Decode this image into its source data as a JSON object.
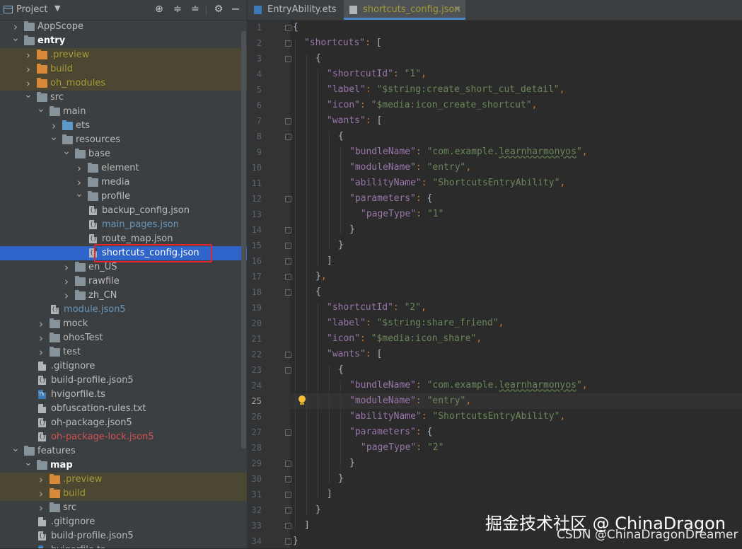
{
  "project": {
    "title": "Project",
    "icons": {
      "toggle": "chevron-down-icon",
      "locate": "crosshair-icon",
      "expand_all": "expand-all-icon",
      "collapse_all": "collapse-all-icon",
      "settings": "gear-icon"
    },
    "tree": [
      {
        "label": "AppScope",
        "depth": 0,
        "kind": "folder",
        "arrow": "collapsed",
        "style": "normal"
      },
      {
        "label": "entry",
        "depth": 0,
        "kind": "module",
        "arrow": "expanded",
        "style": "bold"
      },
      {
        "label": ".preview",
        "depth": 1,
        "kind": "folder-excluded",
        "arrow": "collapsed",
        "style": "yellow",
        "excluded": true
      },
      {
        "label": "build",
        "depth": 1,
        "kind": "folder-excluded",
        "arrow": "collapsed",
        "style": "yellow",
        "excluded": true
      },
      {
        "label": "oh_modules",
        "depth": 1,
        "kind": "folder-excluded",
        "arrow": "collapsed",
        "style": "yellow",
        "excluded": true
      },
      {
        "label": "src",
        "depth": 1,
        "kind": "folder",
        "arrow": "expanded",
        "style": "normal"
      },
      {
        "label": "main",
        "depth": 2,
        "kind": "folder",
        "arrow": "expanded",
        "style": "normal"
      },
      {
        "label": "ets",
        "depth": 3,
        "kind": "folder-source",
        "arrow": "collapsed",
        "style": "normal"
      },
      {
        "label": "resources",
        "depth": 3,
        "kind": "folder",
        "arrow": "expanded",
        "style": "normal"
      },
      {
        "label": "base",
        "depth": 4,
        "kind": "folder",
        "arrow": "expanded",
        "style": "normal"
      },
      {
        "label": "element",
        "depth": 5,
        "kind": "folder",
        "arrow": "collapsed",
        "style": "normal"
      },
      {
        "label": "media",
        "depth": 5,
        "kind": "folder",
        "arrow": "collapsed",
        "style": "normal"
      },
      {
        "label": "profile",
        "depth": 5,
        "kind": "folder",
        "arrow": "expanded",
        "style": "normal"
      },
      {
        "label": "backup_config.json",
        "depth": 6,
        "kind": "json",
        "arrow": "none",
        "style": "normal"
      },
      {
        "label": "main_pages.json",
        "depth": 6,
        "kind": "json",
        "arrow": "none",
        "style": "blue"
      },
      {
        "label": "route_map.json",
        "depth": 6,
        "kind": "json",
        "arrow": "none",
        "style": "normal"
      },
      {
        "label": "shortcuts_config.json",
        "depth": 6,
        "kind": "json",
        "arrow": "none",
        "style": "white",
        "selected": true
      },
      {
        "label": "en_US",
        "depth": 4,
        "kind": "folder",
        "arrow": "collapsed",
        "style": "normal"
      },
      {
        "label": "rawfile",
        "depth": 4,
        "kind": "folder",
        "arrow": "collapsed",
        "style": "normal"
      },
      {
        "label": "zh_CN",
        "depth": 4,
        "kind": "folder",
        "arrow": "collapsed",
        "style": "normal"
      },
      {
        "label": "module.json5",
        "depth": 3,
        "kind": "json",
        "arrow": "none",
        "style": "blue"
      },
      {
        "label": "mock",
        "depth": 2,
        "kind": "folder",
        "arrow": "collapsed",
        "style": "normal"
      },
      {
        "label": "ohosTest",
        "depth": 2,
        "kind": "folder",
        "arrow": "collapsed",
        "style": "normal"
      },
      {
        "label": "test",
        "depth": 2,
        "kind": "folder",
        "arrow": "collapsed",
        "style": "normal"
      },
      {
        "label": ".gitignore",
        "depth": 2,
        "kind": "file",
        "arrow": "none",
        "style": "normal"
      },
      {
        "label": "build-profile.json5",
        "depth": 2,
        "kind": "json",
        "arrow": "none",
        "style": "normal"
      },
      {
        "label": "hvigorfile.ts",
        "depth": 2,
        "kind": "ts",
        "arrow": "none",
        "style": "normal"
      },
      {
        "label": "obfuscation-rules.txt",
        "depth": 2,
        "kind": "file",
        "arrow": "none",
        "style": "normal"
      },
      {
        "label": "oh-package.json5",
        "depth": 2,
        "kind": "json",
        "arrow": "none",
        "style": "normal"
      },
      {
        "label": "oh-package-lock.json5",
        "depth": 2,
        "kind": "json",
        "arrow": "none",
        "style": "red"
      },
      {
        "label": "features",
        "depth": 0,
        "kind": "folder",
        "arrow": "expanded",
        "style": "normal"
      },
      {
        "label": "map",
        "depth": 1,
        "kind": "module",
        "arrow": "expanded",
        "style": "bold"
      },
      {
        "label": ".preview",
        "depth": 2,
        "kind": "folder-excluded",
        "arrow": "collapsed",
        "style": "yellow",
        "excluded": true
      },
      {
        "label": "build",
        "depth": 2,
        "kind": "folder-excluded",
        "arrow": "collapsed",
        "style": "yellow",
        "excluded": true
      },
      {
        "label": "src",
        "depth": 2,
        "kind": "folder",
        "arrow": "collapsed",
        "style": "normal"
      },
      {
        "label": ".gitignore",
        "depth": 2,
        "kind": "file",
        "arrow": "none",
        "style": "normal"
      },
      {
        "label": "build-profile.json5",
        "depth": 2,
        "kind": "json",
        "arrow": "none",
        "style": "normal"
      },
      {
        "label": "hvigorfile.ts",
        "depth": 2,
        "kind": "ts",
        "arrow": "none",
        "style": "normal"
      }
    ]
  },
  "editor": {
    "tabs": [
      {
        "label": "EntryAbility.ets",
        "icon": "ets-file-icon",
        "active": false
      },
      {
        "label": "shortcuts_config.json",
        "icon": "json-file-icon",
        "active": true
      }
    ],
    "current_line": 25,
    "lines": [
      [
        [
          "b",
          "{"
        ]
      ],
      [
        [
          "k",
          "\"shortcuts\""
        ],
        [
          "p",
          ": "
        ],
        [
          "b",
          "["
        ]
      ],
      [
        [
          "b",
          "{"
        ]
      ],
      [
        [
          "k",
          "\"shortcutId\""
        ],
        [
          "p",
          ": "
        ],
        [
          "s",
          "\"1\""
        ],
        [
          "p",
          ","
        ]
      ],
      [
        [
          "k",
          "\"label\""
        ],
        [
          "p",
          ": "
        ],
        [
          "s",
          "\"$string:create_short_cut_detail\""
        ],
        [
          "p",
          ","
        ]
      ],
      [
        [
          "k",
          "\"icon\""
        ],
        [
          "p",
          ": "
        ],
        [
          "s",
          "\"$media:icon_create_shortcut\""
        ],
        [
          "p",
          ","
        ]
      ],
      [
        [
          "k",
          "\"wants\""
        ],
        [
          "p",
          ": "
        ],
        [
          "b",
          "["
        ]
      ],
      [
        [
          "b",
          "{"
        ]
      ],
      [
        [
          "k",
          "\"bundleName\""
        ],
        [
          "p",
          ": "
        ],
        [
          "s",
          "\"com.example."
        ],
        [
          "sq",
          "learnharmonyos"
        ],
        [
          "s",
          "\""
        ],
        [
          "p",
          ","
        ]
      ],
      [
        [
          "k",
          "\"moduleName\""
        ],
        [
          "p",
          ": "
        ],
        [
          "s",
          "\"entry\""
        ],
        [
          "p",
          ","
        ]
      ],
      [
        [
          "k",
          "\"abilityName\""
        ],
        [
          "p",
          ": "
        ],
        [
          "s",
          "\"ShortcutsEntryAbility\""
        ],
        [
          "p",
          ","
        ]
      ],
      [
        [
          "k",
          "\"parameters\""
        ],
        [
          "p",
          ": "
        ],
        [
          "b",
          "{"
        ]
      ],
      [
        [
          "k",
          "\"pageType\""
        ],
        [
          "p",
          ": "
        ],
        [
          "s",
          "\"1\""
        ]
      ],
      [
        [
          "b",
          "}"
        ]
      ],
      [
        [
          "b",
          "}"
        ]
      ],
      [
        [
          "b",
          "]"
        ]
      ],
      [
        [
          "b",
          "}"
        ],
        [
          "p",
          ","
        ]
      ],
      [
        [
          "b",
          "{"
        ]
      ],
      [
        [
          "k",
          "\"shortcutId\""
        ],
        [
          "p",
          ": "
        ],
        [
          "s",
          "\"2\""
        ],
        [
          "p",
          ","
        ]
      ],
      [
        [
          "k",
          "\"label\""
        ],
        [
          "p",
          ": "
        ],
        [
          "s",
          "\"$string:share_friend\""
        ],
        [
          "p",
          ","
        ]
      ],
      [
        [
          "k",
          "\"icon\""
        ],
        [
          "p",
          ": "
        ],
        [
          "s",
          "\"$media:icon_share\""
        ],
        [
          "p",
          ","
        ]
      ],
      [
        [
          "k",
          "\"wants\""
        ],
        [
          "p",
          ": "
        ],
        [
          "b",
          "["
        ]
      ],
      [
        [
          "b",
          "{"
        ]
      ],
      [
        [
          "k",
          "\"bundleName\""
        ],
        [
          "p",
          ": "
        ],
        [
          "s",
          "\"com.example."
        ],
        [
          "sq",
          "learnharmonyos"
        ],
        [
          "s",
          "\""
        ],
        [
          "p",
          ","
        ]
      ],
      [
        [
          "k",
          "\"moduleName\""
        ],
        [
          "p",
          ": "
        ],
        [
          "s",
          "\"entry\""
        ],
        [
          "p",
          ","
        ]
      ],
      [
        [
          "k",
          "\"abilityName\""
        ],
        [
          "p",
          ": "
        ],
        [
          "s",
          "\"ShortcutsEntryAbility\""
        ],
        [
          "p",
          ","
        ]
      ],
      [
        [
          "k",
          "\"parameters\""
        ],
        [
          "p",
          ": "
        ],
        [
          "b",
          "{"
        ]
      ],
      [
        [
          "k",
          "\"pageType\""
        ],
        [
          "p",
          ": "
        ],
        [
          "s",
          "\"2\""
        ]
      ],
      [
        [
          "b",
          "}"
        ]
      ],
      [
        [
          "b",
          "}"
        ]
      ],
      [
        [
          "b",
          "]"
        ]
      ],
      [
        [
          "b",
          "}"
        ]
      ],
      [
        [
          "b",
          "]"
        ]
      ],
      [
        [
          "b",
          "}"
        ]
      ]
    ],
    "indents": [
      0,
      1,
      2,
      3,
      3,
      3,
      3,
      4,
      5,
      5,
      5,
      5,
      6,
      5,
      4,
      3,
      2,
      2,
      3,
      3,
      3,
      3,
      4,
      5,
      5,
      5,
      5,
      6,
      5,
      4,
      3,
      2,
      1,
      0
    ],
    "folds": [
      1,
      2,
      3,
      7,
      8,
      12,
      14,
      15,
      16,
      17,
      18,
      22,
      23,
      27,
      29,
      30,
      31,
      32,
      33,
      34
    ],
    "intention_icon": "lightbulb-icon"
  },
  "watermark": {
    "main": "掘金技术社区 @ ChinaDragon",
    "sub": "CSDN @ChinaDragonDreamer"
  },
  "colors": {
    "selection": "#2f65ca",
    "highlight_box": "#e0262a",
    "key": "#9876aa",
    "string": "#6a8759",
    "punctuation": "#cc7832"
  }
}
